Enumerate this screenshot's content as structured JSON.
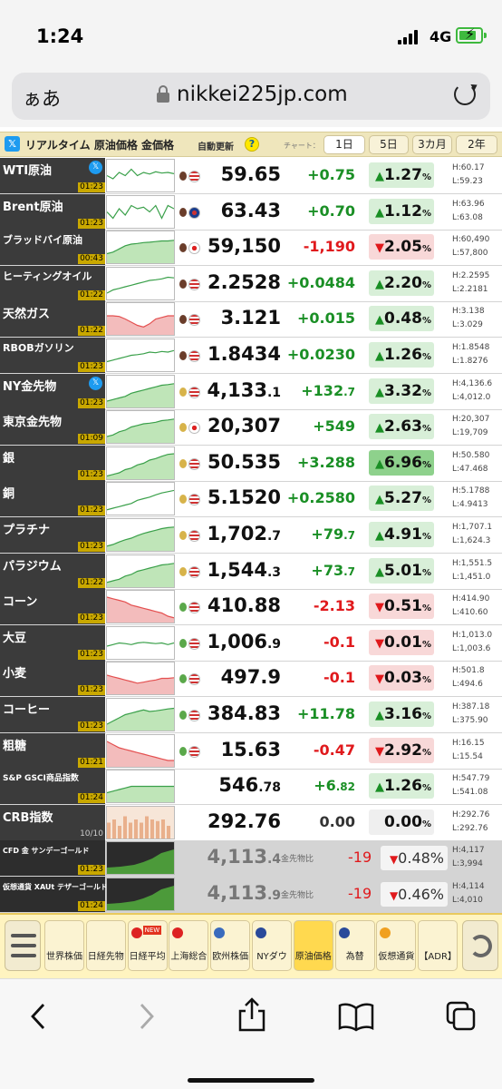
{
  "status_bar": {
    "time": "1:24",
    "network": "4G"
  },
  "browser": {
    "aa_label": "ぁあ",
    "host": "nikkei225jp.com"
  },
  "toolbar": {
    "title": "リアルタイム 原油価格 金価格",
    "auto_update": "自動更新",
    "help": "?",
    "chart_label": "チャート：",
    "tabs": [
      "1日",
      "5日",
      "3カ月",
      "2年"
    ],
    "selected_tab": "1日"
  },
  "rows": [
    {
      "name": "WTI原油",
      "time": "01:23",
      "x": true,
      "price": "59.65",
      "price_dec": "",
      "change": "+0.75",
      "change_dec": "",
      "pct": "1.27",
      "dir": "up",
      "high": "H:60.17",
      "low": "L:59.23",
      "trend": [
        0.5,
        0.4,
        0.6,
        0.5,
        0.7,
        0.5,
        0.6,
        0.55,
        0.62,
        0.58,
        0.6,
        0.56
      ],
      "fill": "line",
      "flag": "us",
      "drop": "oil"
    },
    {
      "name": "Brent原油",
      "time": "01:23",
      "x": false,
      "price": "63.43",
      "price_dec": "",
      "change": "+0.70",
      "change_dec": "",
      "pct": "1.12",
      "dir": "up",
      "high": "H:63.96",
      "low": "L:63.08",
      "trend": [
        0.5,
        0.3,
        0.6,
        0.4,
        0.7,
        0.6,
        0.65,
        0.5,
        0.7,
        0.3,
        0.7,
        0.6
      ],
      "fill": "line",
      "flag": "uk",
      "drop": "oil"
    },
    {
      "name": "ブラッドバイ原油",
      "time": "00:43",
      "x": false,
      "price": "59,150",
      "price_dec": "",
      "change": "-1,190",
      "change_dec": "",
      "pct": "2.05",
      "dir": "dn",
      "high": "H:60,490",
      "low": "L:57,800",
      "trend": [
        0.3,
        0.35,
        0.45,
        0.55,
        0.6,
        0.62,
        0.65,
        0.66,
        0.68,
        0.7,
        0.7,
        0.72
      ],
      "fill": "green",
      "flag": "jp",
      "drop": "oil"
    },
    {
      "name": "ヒーティングオイル",
      "time": "01:22",
      "x": false,
      "price": "2.2528",
      "price_dec": "",
      "change": "+0.0484",
      "change_dec": "",
      "pct": "2.20",
      "dir": "up",
      "high": "H:2.2595",
      "low": "L:2.2181",
      "trend": [
        0.2,
        0.3,
        0.35,
        0.4,
        0.45,
        0.5,
        0.55,
        0.6,
        0.62,
        0.65,
        0.7,
        0.68
      ],
      "fill": "line",
      "flag": "us",
      "drop": "oil"
    },
    {
      "name": "天然ガス",
      "time": "01:22",
      "x": false,
      "price": "3.121",
      "price_dec": "",
      "change": "+0.015",
      "change_dec": "",
      "pct": "0.48",
      "dir": "up",
      "high": "H:3.138",
      "low": "L:3.029",
      "trend": [
        0.6,
        0.6,
        0.58,
        0.5,
        0.4,
        0.3,
        0.25,
        0.35,
        0.5,
        0.55,
        0.6,
        0.6
      ],
      "fill": "red",
      "flag": "us",
      "drop": "oil"
    },
    {
      "name": "RBOBガソリン",
      "time": "01:23",
      "x": false,
      "price": "1.8434",
      "price_dec": "",
      "change": "+0.0230",
      "change_dec": "",
      "pct": "1.26",
      "dir": "up",
      "high": "H:1.8548",
      "low": "L:1.8276",
      "trend": [
        0.3,
        0.35,
        0.4,
        0.45,
        0.5,
        0.52,
        0.55,
        0.6,
        0.58,
        0.62,
        0.6,
        0.65
      ],
      "fill": "line",
      "flag": "us",
      "drop": "oil"
    },
    {
      "name": "NY金先物",
      "time": "01:23",
      "x": true,
      "price": "4,133",
      "price_dec": ".1",
      "change": "+132",
      "change_dec": ".7",
      "pct": "3.32",
      "dir": "up",
      "high": "H:4,136.6",
      "low": "L:4,012.0",
      "trend": [
        0.2,
        0.25,
        0.3,
        0.35,
        0.45,
        0.5,
        0.55,
        0.6,
        0.65,
        0.7,
        0.72,
        0.75
      ],
      "fill": "green",
      "flag": "us",
      "drop": "gold"
    },
    {
      "name": "東京金先物",
      "time": "01:09",
      "x": false,
      "price": "20,307",
      "price_dec": "",
      "change": "+549",
      "change_dec": "",
      "pct": "2.63",
      "dir": "up",
      "high": "H:20,307",
      "low": "L:19,709",
      "trend": [
        0.2,
        0.25,
        0.35,
        0.4,
        0.5,
        0.55,
        0.6,
        0.62,
        0.65,
        0.7,
        0.72,
        0.75
      ],
      "fill": "green",
      "flag": "jp",
      "drop": "gold"
    },
    {
      "name": "銀",
      "time": "01:23",
      "x": false,
      "price": "50.535",
      "price_dec": "",
      "change": "+3.288",
      "change_dec": "",
      "pct": "6.96",
      "dir": "up2",
      "high": "H:50.580",
      "low": "L:47.468",
      "trend": [
        0.1,
        0.15,
        0.2,
        0.3,
        0.35,
        0.45,
        0.5,
        0.6,
        0.65,
        0.72,
        0.78,
        0.8
      ],
      "fill": "green",
      "flag": "us",
      "drop": "gold"
    },
    {
      "name": "銅",
      "time": "01:23",
      "x": false,
      "price": "5.1520",
      "price_dec": "",
      "change": "+0.2580",
      "change_dec": "",
      "pct": "5.27",
      "dir": "up",
      "high": "H:5.1788",
      "low": "L:4.9413",
      "trend": [
        0.15,
        0.2,
        0.25,
        0.3,
        0.35,
        0.45,
        0.5,
        0.55,
        0.62,
        0.68,
        0.72,
        0.76
      ],
      "fill": "line",
      "flag": "us",
      "drop": "gold"
    },
    {
      "name": "プラチナ",
      "time": "01:23",
      "x": false,
      "price": "1,702",
      "price_dec": ".7",
      "change": "+79",
      "change_dec": ".7",
      "pct": "4.91",
      "dir": "up",
      "high": "H:1,707.1",
      "low": "L:1,624.3",
      "trend": [
        0.15,
        0.2,
        0.28,
        0.35,
        0.4,
        0.48,
        0.55,
        0.6,
        0.65,
        0.7,
        0.73,
        0.75
      ],
      "fill": "green",
      "flag": "us",
      "drop": "gold"
    },
    {
      "name": "パラジウム",
      "time": "01:22",
      "x": false,
      "price": "1,544",
      "price_dec": ".3",
      "change": "+73",
      "change_dec": ".7",
      "pct": "5.01",
      "dir": "up",
      "high": "H:1,551.5",
      "low": "L:1,451.0",
      "trend": [
        0.15,
        0.2,
        0.25,
        0.35,
        0.4,
        0.5,
        0.55,
        0.6,
        0.65,
        0.7,
        0.72,
        0.75
      ],
      "fill": "green",
      "flag": "us",
      "drop": "gold"
    },
    {
      "name": "コーン",
      "time": "01:23",
      "x": false,
      "price": "410.88",
      "price_dec": "",
      "change": "-2.13",
      "change_dec": "",
      "pct": "0.51",
      "dir": "dn",
      "high": "H:414.90",
      "low": "L:410.60",
      "trend": [
        0.8,
        0.75,
        0.7,
        0.65,
        0.55,
        0.5,
        0.45,
        0.4,
        0.35,
        0.3,
        0.2,
        0.15
      ],
      "fill": "red",
      "flag": "us",
      "drop": "grain"
    },
    {
      "name": "大豆",
      "time": "01:23",
      "x": false,
      "price": "1,006",
      "price_dec": ".9",
      "change": "-0.1",
      "change_dec": "",
      "pct": "0.01",
      "dir": "dn",
      "high": "H:1,013.0",
      "low": "L:1,003.6",
      "trend": [
        0.4,
        0.45,
        0.5,
        0.48,
        0.45,
        0.5,
        0.52,
        0.5,
        0.48,
        0.5,
        0.45,
        0.5
      ],
      "fill": "line",
      "flag": "us",
      "drop": "grain"
    },
    {
      "name": "小麦",
      "time": "01:23",
      "x": false,
      "price": "497.9",
      "price_dec": "",
      "change": "-0.1",
      "change_dec": "",
      "pct": "0.03",
      "dir": "dn",
      "high": "H:501.8",
      "low": "L:494.6",
      "trend": [
        0.6,
        0.55,
        0.5,
        0.45,
        0.4,
        0.35,
        0.38,
        0.42,
        0.45,
        0.5,
        0.5,
        0.52
      ],
      "fill": "red",
      "flag": "us",
      "drop": "grain"
    },
    {
      "name": "コーヒー",
      "time": "01:23",
      "x": false,
      "price": "384.83",
      "price_dec": "",
      "change": "+11.78",
      "change_dec": "",
      "pct": "3.16",
      "dir": "up",
      "high": "H:387.18",
      "low": "L:375.90",
      "trend": [
        0.2,
        0.3,
        0.4,
        0.5,
        0.55,
        0.6,
        0.65,
        0.6,
        0.62,
        0.65,
        0.68,
        0.7
      ],
      "fill": "green",
      "flag": "us",
      "drop": "grain"
    },
    {
      "name": "粗糖",
      "time": "01:21",
      "x": false,
      "price": "15.63",
      "price_dec": "",
      "change": "-0.47",
      "change_dec": "",
      "pct": "2.92",
      "dir": "dn",
      "high": "H:16.15",
      "low": "L:15.54",
      "trend": [
        0.8,
        0.7,
        0.6,
        0.55,
        0.5,
        0.45,
        0.4,
        0.35,
        0.3,
        0.25,
        0.2,
        0.2
      ],
      "fill": "red",
      "flag": "us",
      "drop": "grain"
    },
    {
      "name": "S&P GSCI商品指数",
      "time": "01:24",
      "x": false,
      "price": "546",
      "price_dec": ".78",
      "change": "+6",
      "change_dec": ".82",
      "pct": "1.26",
      "dir": "up",
      "high": "H:547.79",
      "low": "L:541.08",
      "trend": [
        0.3,
        0.35,
        0.4,
        0.45,
        0.5,
        0.5,
        0.5,
        0.5,
        0.5,
        0.5,
        0.5,
        0.5
      ],
      "fill": "green",
      "flag": "",
      "drop": ""
    },
    {
      "name": "CRB指数",
      "time": "10/10",
      "x": false,
      "price": "292.76",
      "price_dec": "",
      "change": "0.00",
      "change_dec": "",
      "pct": "0.00",
      "dir": "nt",
      "high": "H:292.76",
      "low": "L:292.76",
      "trend": [
        0.5,
        0.6,
        0.4,
        0.7,
        0.5,
        0.6,
        0.5,
        0.7,
        0.6,
        0.55,
        0.6,
        0.4
      ],
      "fill": "bars",
      "flag": "",
      "drop": ""
    }
  ],
  "cfd_rows": [
    {
      "name": "CFD 金 サンデーゴールド",
      "time": "01:23",
      "price": "4,113",
      "price_dec": ".4",
      "tag": "金先物比",
      "change": "-19",
      "pct": "0.48%",
      "high": "H:4,117",
      "low": "L:3,994"
    },
    {
      "name": "仮想通貨 XAUt テザーゴールド",
      "time": "01:24",
      "price": "4,113",
      "price_dec": ".9",
      "tag": "金先物比",
      "change": "-19",
      "pct": "0.46%",
      "high": "H:4,114",
      "low": "L:4,010"
    }
  ],
  "bottom_nav": {
    "items": [
      "世界株価",
      "日経先物",
      "日経平均",
      "上海総合",
      "欧州株価",
      "NYダウ",
      "原油価格",
      "為替",
      "仮想通貨",
      "【ADR】"
    ],
    "new_badge": "NEW",
    "selected": "原油価格"
  },
  "colors": {
    "up": "#1a8f25",
    "down": "#e0191c",
    "accent": "#efe6bc",
    "nav": "#fff4c0"
  }
}
